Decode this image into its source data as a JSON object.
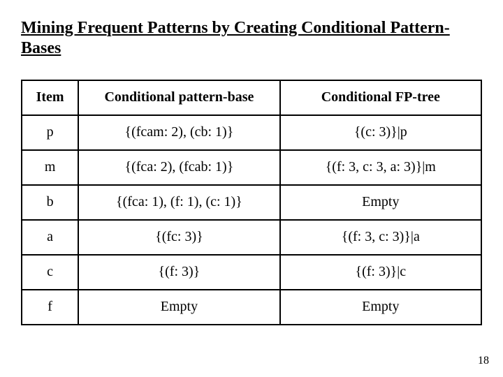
{
  "title": "Mining Frequent Patterns by Creating Conditional Pattern-Bases",
  "headers": {
    "item": "Item",
    "cpb": "Conditional pattern-base",
    "fpt": "Conditional FP-tree"
  },
  "rows": [
    {
      "item": "p",
      "cpb": "{(fcam: 2), (cb: 1)}",
      "fpt": "{(c: 3)}|p"
    },
    {
      "item": "m",
      "cpb": "{(fca: 2), (fcab: 1)}",
      "fpt": "{(f: 3, c: 3, a: 3)}|m"
    },
    {
      "item": "b",
      "cpb": "{(fca: 1), (f: 1), (c: 1)}",
      "fpt": "Empty"
    },
    {
      "item": "a",
      "cpb": "{(fc: 3)}",
      "fpt": "{(f: 3, c: 3)}|a"
    },
    {
      "item": "c",
      "cpb": "{(f: 3)}",
      "fpt": "{(f: 3)}|c"
    },
    {
      "item": "f",
      "cpb": "Empty",
      "fpt": "Empty"
    }
  ],
  "page_number": "18",
  "chart_data": {
    "type": "table",
    "title": "Mining Frequent Patterns by Creating Conditional Pattern-Bases",
    "columns": [
      "Item",
      "Conditional pattern-base",
      "Conditional FP-tree"
    ],
    "rows": [
      [
        "p",
        "{(fcam: 2), (cb: 1)}",
        "{(c: 3)}|p"
      ],
      [
        "m",
        "{(fca: 2), (fcab: 1)}",
        "{(f: 3, c: 3, a: 3)}|m"
      ],
      [
        "b",
        "{(fca: 1), (f: 1), (c: 1)}",
        "Empty"
      ],
      [
        "a",
        "{(fc: 3)}",
        "{(f: 3, c: 3)}|a"
      ],
      [
        "c",
        "{(f: 3)}",
        "{(f: 3)}|c"
      ],
      [
        "f",
        "Empty",
        "Empty"
      ]
    ]
  }
}
